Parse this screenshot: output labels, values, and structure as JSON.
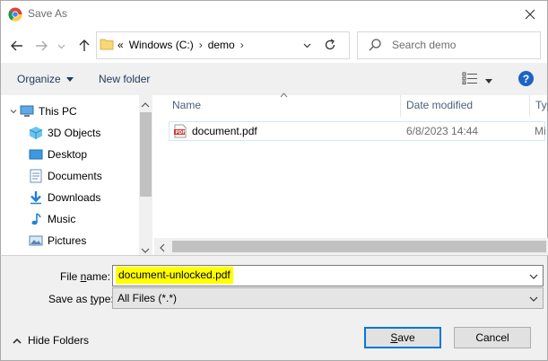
{
  "window": {
    "title": "Save As",
    "close_icon": "close-icon"
  },
  "nav": {
    "back_icon": "arrow-left-icon",
    "forward_icon": "arrow-right-icon",
    "recent_icon": "chevron-down-icon",
    "up_icon": "arrow-up-icon",
    "address": {
      "overflow": "«",
      "crumbs": [
        "Windows (C:)",
        "demo"
      ],
      "separator": "›"
    },
    "refresh_icon": "refresh-icon",
    "search_placeholder": "Search demo"
  },
  "toolbar": {
    "organize_label": "Organize",
    "new_folder_label": "New folder",
    "help_label": "?"
  },
  "sidebar": {
    "items": [
      {
        "label": "This PC",
        "icon": "computer-icon"
      },
      {
        "label": "3D Objects",
        "icon": "cube-icon"
      },
      {
        "label": "Desktop",
        "icon": "desktop-icon"
      },
      {
        "label": "Documents",
        "icon": "document-icon"
      },
      {
        "label": "Downloads",
        "icon": "download-icon"
      },
      {
        "label": "Music",
        "icon": "music-icon"
      },
      {
        "label": "Pictures",
        "icon": "pictures-icon"
      }
    ]
  },
  "files": {
    "columns": [
      "Name",
      "Date modified",
      "Typ"
    ],
    "rows": [
      {
        "name": "document.pdf",
        "date": "6/8/2023 14:44",
        "type": "Mi",
        "icon": "pdf-icon"
      }
    ]
  },
  "form": {
    "file_name_label_pre": "File ",
    "file_name_label_acc": "n",
    "file_name_label_post": "ame:",
    "file_name_value": "document-unlocked.pdf",
    "save_type_label_pre": "Save as ",
    "save_type_label_acc": "t",
    "save_type_label_post": "ype:",
    "save_type_value": "All Files (*.*)",
    "hide_folders_label": "Hide Folders",
    "save_label_acc": "S",
    "save_label_post": "ave",
    "cancel_label": "Cancel"
  },
  "colors": {
    "accent": "#0078d7",
    "highlight": "#ffff00",
    "help": "#1d64c4",
    "selected_border": "#cde8ff"
  }
}
